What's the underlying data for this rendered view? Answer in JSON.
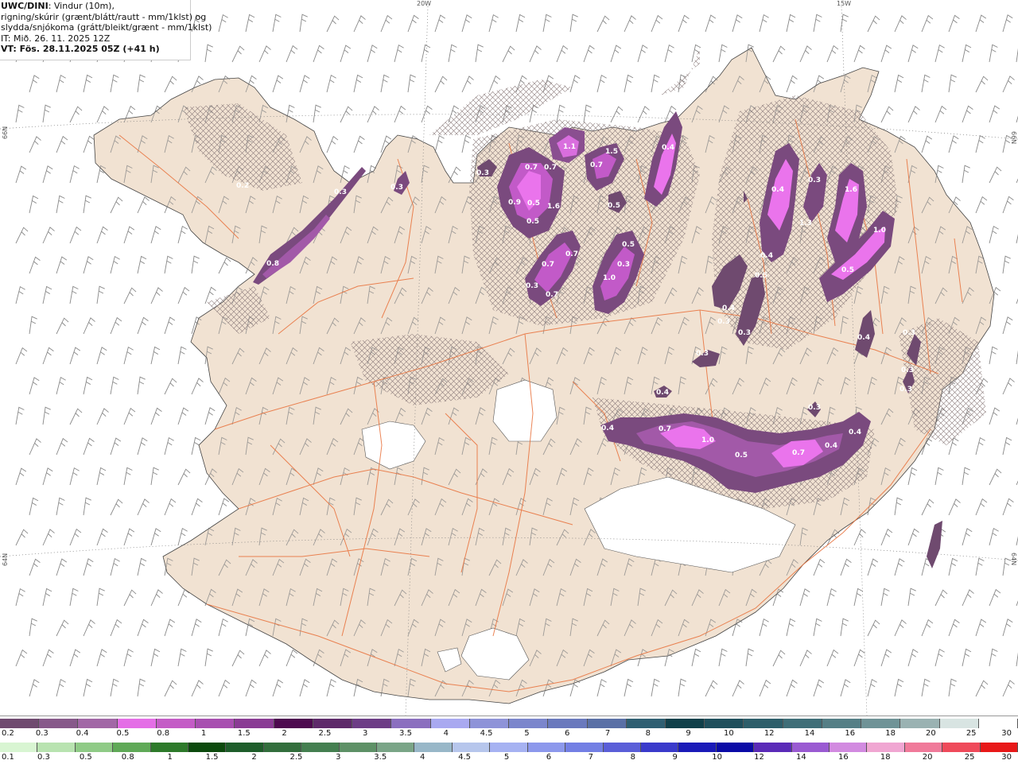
{
  "header": {
    "model": "UWC/DINI",
    "line1_rest": ": Vindur (10m),",
    "line2": "rigning/skúrir (grænt/blátt/rautt - mm/1klst) og",
    "line3": "slydda/snjókoma (grátt/bleikt/grænt - mm/1klst)",
    "line4": "IT: Mið. 26. 11. 2025 12Z",
    "line5": "VT: Fös. 28.11.2025 05Z (+41 h)"
  },
  "map": {
    "colors": {
      "land": "#f1e2d2",
      "sea": "#ffffff",
      "roads": "#e8703a",
      "glacier": "#ffffff",
      "coast": "#333333"
    },
    "graticule_labels": {
      "top_20w": "20W",
      "top_15w": "15W",
      "left_66n": "66N",
      "right_66n": "66N",
      "left_64n": "64N",
      "right_64n": "64N"
    },
    "blob_labels": [
      "0.2",
      "0.3",
      "0.8",
      "0.3",
      "0.3",
      "0.7",
      "0.7",
      "0.9",
      "0.5",
      "0.5",
      "1.6",
      "1.1",
      "0.7",
      "1.5",
      "0.4",
      "0.5",
      "0.5",
      "0.3",
      "0.7",
      "0.3",
      "0.7",
      "0.7",
      "1.0",
      "0.4",
      "0.3",
      "1.3",
      "1.6",
      "1.0",
      "0.5",
      "0.4",
      "0.5",
      "0.4",
      "0.3",
      "0.3",
      "0.3",
      "0.4",
      "0.3",
      "0.3",
      "0.3",
      "0.4",
      "0.7",
      "1.0",
      "0.5",
      "0.7",
      "0.4",
      "0.4",
      "0.4",
      "0.3"
    ]
  },
  "legend": {
    "snow_colors": [
      "#6f4a6f",
      "#87598a",
      "#a267a6",
      "#e46ee6",
      "#c45cc6",
      "#a84fb0",
      "#8a3c94",
      "#4d0a4f",
      "#5e2a6a",
      "#6d3d86",
      "#8b6fbf",
      "#a9a9f0",
      "#8e93d8",
      "#7b86cc",
      "#6a79bd",
      "#5a70a6",
      "#2f5f72",
      "#10404a",
      "#1f4f5c",
      "#2d5e6a",
      "#3f6e78",
      "#557f86",
      "#6f9397",
      "#9ab2b2",
      "#d8e4e2",
      "#ffffff"
    ],
    "snow_labels": [
      "0.2",
      "0.3",
      "0.4",
      "0.5",
      "0.8",
      "1",
      "1.5",
      "2",
      "2.5",
      "3",
      "3.5",
      "4",
      "4.5",
      "5",
      "6",
      "7",
      "8",
      "9",
      "10",
      "12",
      "14",
      "16",
      "18",
      "20",
      "25",
      "30"
    ],
    "rain_colors": [
      "#d8f5d2",
      "#b8e3b0",
      "#8fcb86",
      "#5fa957",
      "#2d7a2a",
      "#0c4a0d",
      "#1e5d2a",
      "#326e3c",
      "#447f50",
      "#5d9166",
      "#7aa587",
      "#98b7c8",
      "#b6c6ec",
      "#a6b2f2",
      "#8c98ec",
      "#737fe4",
      "#5a5ed8",
      "#3a3acb",
      "#1a1ab8",
      "#0a0aa6",
      "#5a2ab8",
      "#9a5ad2",
      "#d28ae0",
      "#f0a6d2",
      "#f07a9a",
      "#ef4a5a",
      "#e81818"
    ],
    "rain_labels": [
      "0.1",
      "0.3",
      "0.5",
      "0.8",
      "1",
      "1.5",
      "2",
      "2.5",
      "3",
      "3.5",
      "4",
      "4.5",
      "5",
      "6",
      "7",
      "8",
      "9",
      "10",
      "12",
      "14",
      "16",
      "18",
      "20",
      "25",
      "30"
    ]
  }
}
